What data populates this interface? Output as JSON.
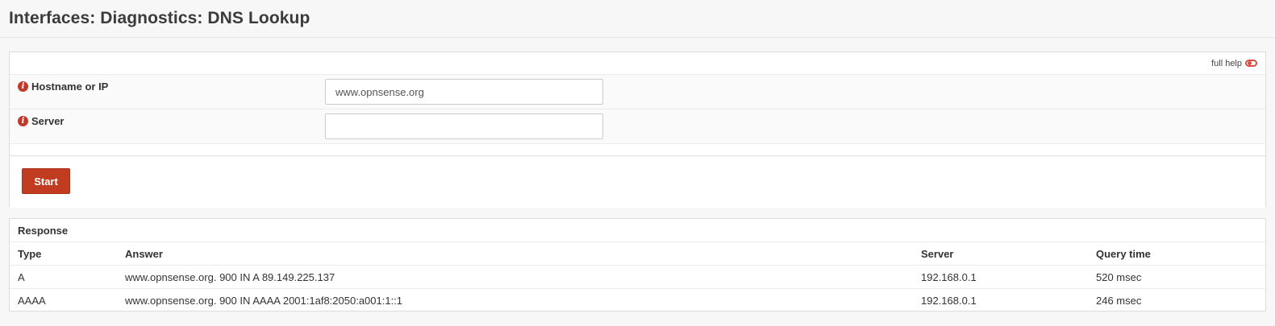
{
  "header": {
    "title": "Interfaces: Diagnostics: DNS Lookup"
  },
  "form": {
    "full_help_label": "full help",
    "hostname": {
      "label": "Hostname or IP",
      "value": "www.opnsense.org"
    },
    "server": {
      "label": "Server",
      "value": ""
    },
    "start_label": "Start"
  },
  "response": {
    "title": "Response",
    "columns": [
      "Type",
      "Answer",
      "Server",
      "Query time"
    ],
    "rows": [
      [
        "A",
        "www.opnsense.org. 900 IN A 89.149.225.137",
        "192.168.0.1",
        "520 msec"
      ],
      [
        "AAAA",
        "www.opnsense.org. 900 IN AAAA 2001:1af8:2050:a001:1::1",
        "192.168.0.1",
        "246 msec"
      ]
    ]
  },
  "colors": {
    "accent": "#c03b1f",
    "info_icon": "#c0392b",
    "toggle": "#d94f43"
  }
}
